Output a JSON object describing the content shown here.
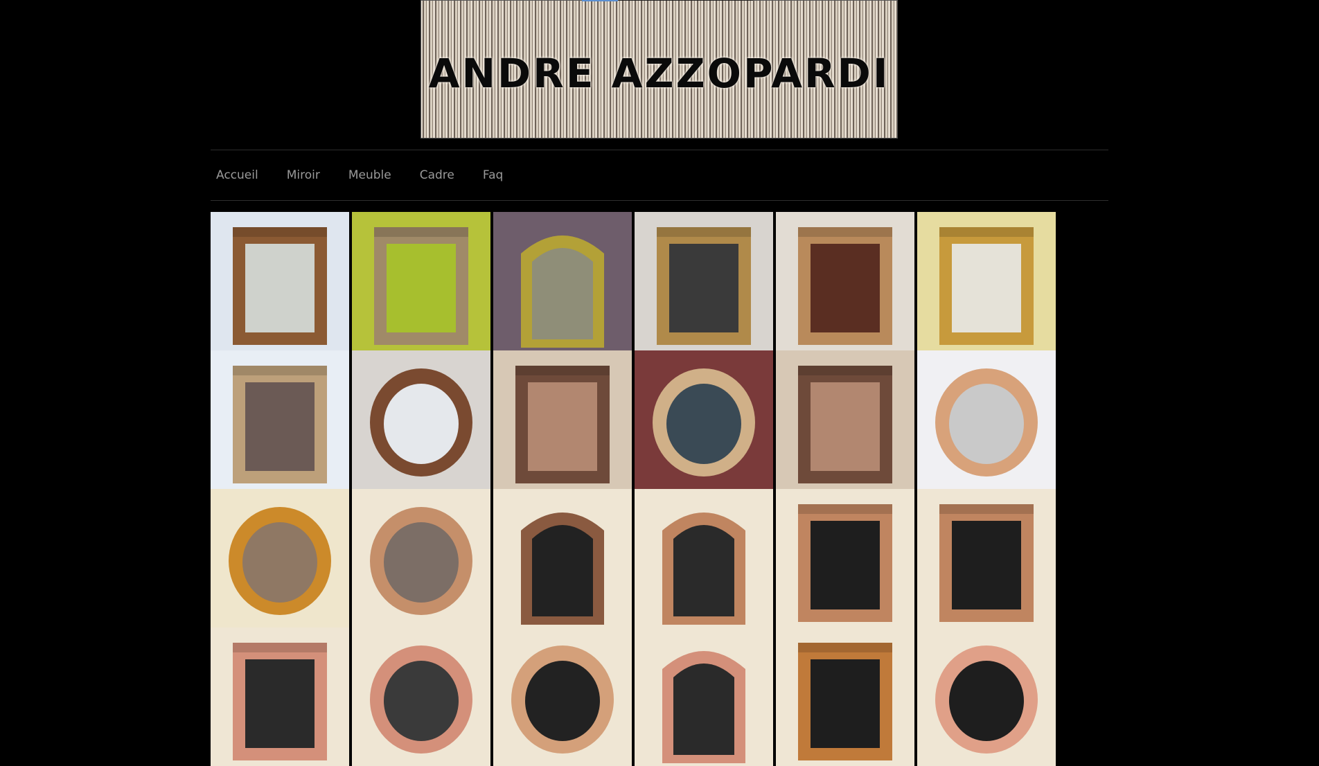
{
  "header": {
    "banner_title": "ANDRE AZZOPARDI"
  },
  "nav": {
    "items": [
      "Accueil",
      "Miroir",
      "Meuble",
      "Cadre",
      "Faq"
    ]
  },
  "gallery": {
    "tiles": [
      {
        "bg": "#dfe6ef",
        "frame": "#8b5a33",
        "mirror": "#cfd2cc",
        "shape": "rect"
      },
      {
        "bg": "#b6c23a",
        "frame": "#a08a68",
        "mirror": "#a7bf2e",
        "shape": "rect"
      },
      {
        "bg": "#6e5d6b",
        "frame": "#b3a137",
        "mirror": "#8f8e78",
        "shape": "arch"
      },
      {
        "bg": "#d8d4cf",
        "frame": "#b08a4a",
        "mirror": "#3a3a3a",
        "shape": "rect"
      },
      {
        "bg": "#e2dcd3",
        "frame": "#b98a5b",
        "mirror": "#5a2e22",
        "shape": "rect"
      },
      {
        "bg": "#e6dca0",
        "frame": "#c79a3c",
        "mirror": "#e5e2d8",
        "shape": "rect"
      },
      {
        "bg": "#e8eef5",
        "frame": "#bda07a",
        "mirror": "#6b5a55",
        "shape": "rect"
      },
      {
        "bg": "#d8d4d0",
        "frame": "#7a4a30",
        "mirror": "#e5e8ec",
        "shape": "oval"
      },
      {
        "bg": "#d7c8b5",
        "frame": "#6e4a3a",
        "mirror": "#b28770",
        "shape": "rect"
      },
      {
        "bg": "#7a3a3a",
        "frame": "#d0b088",
        "mirror": "#3a4a55",
        "shape": "oval"
      },
      {
        "bg": "#d7c8b5",
        "frame": "#6e4a3a",
        "mirror": "#b28770",
        "shape": "rect"
      },
      {
        "bg": "#f0f0f3",
        "frame": "#d8a27a",
        "mirror": "#c9c9c9",
        "shape": "oval"
      },
      {
        "bg": "#efe6cc",
        "frame": "#cc8a2a",
        "mirror": "#8f7864",
        "shape": "oval"
      },
      {
        "bg": "#efe6d4",
        "frame": "#c58f6a",
        "mirror": "#7c6e66",
        "shape": "oval"
      },
      {
        "bg": "#efe6d4",
        "frame": "#8a5a40",
        "mirror": "#222222",
        "shape": "arch"
      },
      {
        "bg": "#efe6d4",
        "frame": "#c08560",
        "mirror": "#2a2a2a",
        "shape": "arch"
      },
      {
        "bg": "#efe6d4",
        "frame": "#c08560",
        "mirror": "#1e1e1e",
        "shape": "rect"
      },
      {
        "bg": "#efe6d4",
        "frame": "#c08560",
        "mirror": "#1e1e1e",
        "shape": "rect"
      },
      {
        "bg": "#efe6d4",
        "frame": "#d4907a",
        "mirror": "#2a2a2a",
        "shape": "rect"
      },
      {
        "bg": "#efe6d4",
        "frame": "#d4907a",
        "mirror": "#3a3a3a",
        "shape": "oval"
      },
      {
        "bg": "#efe6d4",
        "frame": "#d4a07a",
        "mirror": "#222222",
        "shape": "oval"
      },
      {
        "bg": "#efe6d4",
        "frame": "#d4907a",
        "mirror": "#2a2a2a",
        "shape": "arch"
      },
      {
        "bg": "#efe6d4",
        "frame": "#c07a3a",
        "mirror": "#1e1e1e",
        "shape": "rect"
      },
      {
        "bg": "#efe6d4",
        "frame": "#e0a088",
        "mirror": "#1e1e1e",
        "shape": "oval"
      }
    ]
  }
}
